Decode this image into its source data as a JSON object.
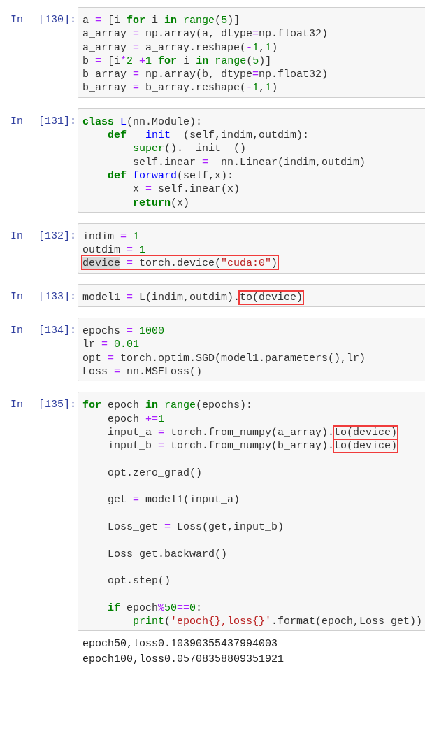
{
  "cells": [
    {
      "label": "In",
      "number": "[130]:",
      "lines": [
        {
          "kind": "code",
          "tokens": [
            {
              "text": "a ",
              "kind": "plain"
            },
            {
              "text": "=",
              "kind": "op"
            },
            {
              "text": " [i ",
              "kind": "plain"
            },
            {
              "text": "for",
              "kind": "kw"
            },
            {
              "text": " i ",
              "kind": "plain"
            },
            {
              "text": "in ",
              "kind": "kw"
            },
            {
              "text": "range",
              "kind": "builtin"
            },
            {
              "text": "(",
              "kind": "plain"
            },
            {
              "text": "5",
              "kind": "num"
            },
            {
              "text": ")]",
              "kind": "plain"
            }
          ]
        },
        {
          "kind": "code",
          "tokens": [
            {
              "text": "a_array ",
              "kind": "plain"
            },
            {
              "text": "=",
              "kind": "op"
            },
            {
              "text": " np.array(a, dtype",
              "kind": "plain"
            },
            {
              "text": "=",
              "kind": "op"
            },
            {
              "text": "np.float32)",
              "kind": "plain"
            }
          ]
        },
        {
          "kind": "code",
          "tokens": [
            {
              "text": "a_array ",
              "kind": "plain"
            },
            {
              "text": "=",
              "kind": "op"
            },
            {
              "text": " a_array.reshape(",
              "kind": "plain"
            },
            {
              "text": "-",
              "kind": "op"
            },
            {
              "text": "1",
              "kind": "num"
            },
            {
              "text": ",",
              "kind": "plain"
            },
            {
              "text": "1",
              "kind": "num"
            },
            {
              "text": ")",
              "kind": "plain"
            }
          ]
        },
        {
          "kind": "code",
          "tokens": [
            {
              "text": "b ",
              "kind": "plain"
            },
            {
              "text": "=",
              "kind": "op"
            },
            {
              "text": " [i",
              "kind": "plain"
            },
            {
              "text": "*",
              "kind": "op"
            },
            {
              "text": "2 ",
              "kind": "num"
            },
            {
              "text": "+",
              "kind": "op"
            },
            {
              "text": "1 ",
              "kind": "num"
            },
            {
              "text": "for",
              "kind": "kw"
            },
            {
              "text": " i ",
              "kind": "plain"
            },
            {
              "text": "in ",
              "kind": "kw"
            },
            {
              "text": "range",
              "kind": "builtin"
            },
            {
              "text": "(",
              "kind": "plain"
            },
            {
              "text": "5",
              "kind": "num"
            },
            {
              "text": ")]",
              "kind": "plain"
            }
          ]
        },
        {
          "kind": "code",
          "tokens": [
            {
              "text": "b_array ",
              "kind": "plain"
            },
            {
              "text": "=",
              "kind": "op"
            },
            {
              "text": " np.array(b, dtype",
              "kind": "plain"
            },
            {
              "text": "=",
              "kind": "op"
            },
            {
              "text": "np.float32)",
              "kind": "plain"
            }
          ]
        },
        {
          "kind": "code",
          "tokens": [
            {
              "text": "b_array ",
              "kind": "plain"
            },
            {
              "text": "=",
              "kind": "op"
            },
            {
              "text": " b_array.reshape(",
              "kind": "plain"
            },
            {
              "text": "-",
              "kind": "op"
            },
            {
              "text": "1",
              "kind": "num"
            },
            {
              "text": ",",
              "kind": "plain"
            },
            {
              "text": "1",
              "kind": "num"
            },
            {
              "text": ")",
              "kind": "plain"
            }
          ]
        }
      ]
    },
    {
      "label": "In",
      "number": "[131]:",
      "lines": [
        {
          "kind": "code",
          "tokens": [
            {
              "text": "class ",
              "kind": "kw"
            },
            {
              "text": "L",
              "kind": "def"
            },
            {
              "text": "(nn.Module):",
              "kind": "plain"
            }
          ]
        },
        {
          "kind": "code",
          "tokens": [
            {
              "text": "    def ",
              "kind": "kw"
            },
            {
              "text": "__init__",
              "kind": "def"
            },
            {
              "text": "(self,indim,outdim):",
              "kind": "plain"
            }
          ]
        },
        {
          "kind": "code",
          "tokens": [
            {
              "text": "        super",
              "kind": "builtin"
            },
            {
              "text": "().__init__()",
              "kind": "plain"
            }
          ]
        },
        {
          "kind": "code",
          "tokens": [
            {
              "text": "        self.inear ",
              "kind": "plain"
            },
            {
              "text": "=",
              "kind": "op"
            },
            {
              "text": "  nn.Linear(indim,outdim)",
              "kind": "plain"
            }
          ]
        },
        {
          "kind": "code",
          "tokens": [
            {
              "text": "    def ",
              "kind": "kw"
            },
            {
              "text": "forward",
              "kind": "def"
            },
            {
              "text": "(self,x):",
              "kind": "plain"
            }
          ]
        },
        {
          "kind": "code",
          "tokens": [
            {
              "text": "        x ",
              "kind": "plain"
            },
            {
              "text": "=",
              "kind": "op"
            },
            {
              "text": " self.inear(x)",
              "kind": "plain"
            }
          ]
        },
        {
          "kind": "code",
          "tokens": [
            {
              "text": "        return",
              "kind": "kw"
            },
            {
              "text": "(x)",
              "kind": "plain"
            }
          ]
        }
      ]
    },
    {
      "label": "In",
      "number": "[132]:",
      "lines": [
        {
          "kind": "code",
          "tokens": [
            {
              "text": "indim ",
              "kind": "plain"
            },
            {
              "text": "= ",
              "kind": "op"
            },
            {
              "text": "1",
              "kind": "num"
            }
          ]
        },
        {
          "kind": "code",
          "tokens": [
            {
              "text": "outdim ",
              "kind": "plain"
            },
            {
              "text": "= ",
              "kind": "op"
            },
            {
              "text": "1",
              "kind": "num"
            }
          ]
        },
        {
          "kind": "code",
          "boxed": true,
          "tokens": [
            {
              "text": "device",
              "kind": "plain",
              "selected": true
            },
            {
              "text": " =",
              "kind": "op"
            },
            {
              "text": " torch.device(",
              "kind": "plain"
            },
            {
              "text": "\"cuda:0\"",
              "kind": "str"
            },
            {
              "text": ")",
              "kind": "plain"
            }
          ]
        }
      ]
    },
    {
      "label": "In",
      "number": "[133]:",
      "lines": [
        {
          "kind": "code",
          "tokens": [
            {
              "text": "model1 ",
              "kind": "plain"
            },
            {
              "text": "=",
              "kind": "op"
            },
            {
              "text": " L(indim,outdim).",
              "kind": "plain"
            },
            {
              "text": "to(device)",
              "kind": "plain",
              "boxed": true
            }
          ]
        }
      ]
    },
    {
      "label": "In",
      "number": "[134]:",
      "lines": [
        {
          "kind": "code",
          "tokens": [
            {
              "text": "epochs ",
              "kind": "plain"
            },
            {
              "text": "= ",
              "kind": "op"
            },
            {
              "text": "1000",
              "kind": "num"
            }
          ]
        },
        {
          "kind": "code",
          "tokens": [
            {
              "text": "lr ",
              "kind": "plain"
            },
            {
              "text": "= ",
              "kind": "op"
            },
            {
              "text": "0.01",
              "kind": "num"
            }
          ]
        },
        {
          "kind": "code",
          "tokens": [
            {
              "text": "opt ",
              "kind": "plain"
            },
            {
              "text": "=",
              "kind": "op"
            },
            {
              "text": " torch.optim.SGD(model1.parameters(),lr)",
              "kind": "plain"
            }
          ]
        },
        {
          "kind": "code",
          "tokens": [
            {
              "text": "Loss ",
              "kind": "plain"
            },
            {
              "text": "=",
              "kind": "op"
            },
            {
              "text": " nn.MSELoss()",
              "kind": "plain"
            }
          ]
        }
      ]
    },
    {
      "label": "In",
      "number": "[135]:",
      "lines": [
        {
          "kind": "code",
          "tokens": [
            {
              "text": "for",
              "kind": "kw"
            },
            {
              "text": " epoch ",
              "kind": "plain"
            },
            {
              "text": "in ",
              "kind": "kw"
            },
            {
              "text": "range",
              "kind": "builtin"
            },
            {
              "text": "(epochs):",
              "kind": "plain"
            }
          ]
        },
        {
          "kind": "code",
          "tokens": [
            {
              "text": "    epoch ",
              "kind": "plain"
            },
            {
              "text": "+=",
              "kind": "op"
            },
            {
              "text": "1",
              "kind": "num"
            }
          ]
        },
        {
          "kind": "code",
          "tokens": [
            {
              "text": "    input_a ",
              "kind": "plain"
            },
            {
              "text": "=",
              "kind": "op"
            },
            {
              "text": " torch.from_numpy(a_array).",
              "kind": "plain"
            },
            {
              "text": "to(device)",
              "kind": "plain",
              "boxed": true
            }
          ]
        },
        {
          "kind": "code",
          "tokens": [
            {
              "text": "    input_b ",
              "kind": "plain"
            },
            {
              "text": "=",
              "kind": "op"
            },
            {
              "text": " torch.from_numpy(b_array).",
              "kind": "plain"
            },
            {
              "text": "to(device)",
              "kind": "plain",
              "boxed": true
            }
          ]
        },
        {
          "kind": "blank"
        },
        {
          "kind": "code",
          "tokens": [
            {
              "text": "    opt.zero_grad()",
              "kind": "plain"
            }
          ]
        },
        {
          "kind": "blank"
        },
        {
          "kind": "code",
          "tokens": [
            {
              "text": "    get ",
              "kind": "plain"
            },
            {
              "text": "=",
              "kind": "op"
            },
            {
              "text": " model1(input_a)",
              "kind": "plain"
            }
          ]
        },
        {
          "kind": "blank"
        },
        {
          "kind": "code",
          "tokens": [
            {
              "text": "    Loss_get ",
              "kind": "plain"
            },
            {
              "text": "=",
              "kind": "op"
            },
            {
              "text": " Loss(get,input_b)",
              "kind": "plain"
            }
          ]
        },
        {
          "kind": "blank"
        },
        {
          "kind": "code",
          "tokens": [
            {
              "text": "    Loss_get.backward()",
              "kind": "plain"
            }
          ]
        },
        {
          "kind": "blank"
        },
        {
          "kind": "code",
          "tokens": [
            {
              "text": "    opt.step()",
              "kind": "plain"
            }
          ]
        },
        {
          "kind": "blank"
        },
        {
          "kind": "code",
          "tokens": [
            {
              "text": "    if",
              "kind": "kw"
            },
            {
              "text": " epoch",
              "kind": "plain"
            },
            {
              "text": "%",
              "kind": "op"
            },
            {
              "text": "50",
              "kind": "num"
            },
            {
              "text": "==",
              "kind": "op"
            },
            {
              "text": "0",
              "kind": "num"
            },
            {
              "text": ":",
              "kind": "plain"
            }
          ]
        },
        {
          "kind": "code",
          "tokens": [
            {
              "text": "        print",
              "kind": "builtin"
            },
            {
              "text": "(",
              "kind": "plain"
            },
            {
              "text": "'epoch{},loss{}'",
              "kind": "str"
            },
            {
              "text": ".format(epoch,Loss_get))",
              "kind": "plain"
            }
          ]
        }
      ],
      "output": [
        "epoch50,loss0.10390355437994003",
        "epoch100,loss0.05708358809351921"
      ]
    }
  ]
}
